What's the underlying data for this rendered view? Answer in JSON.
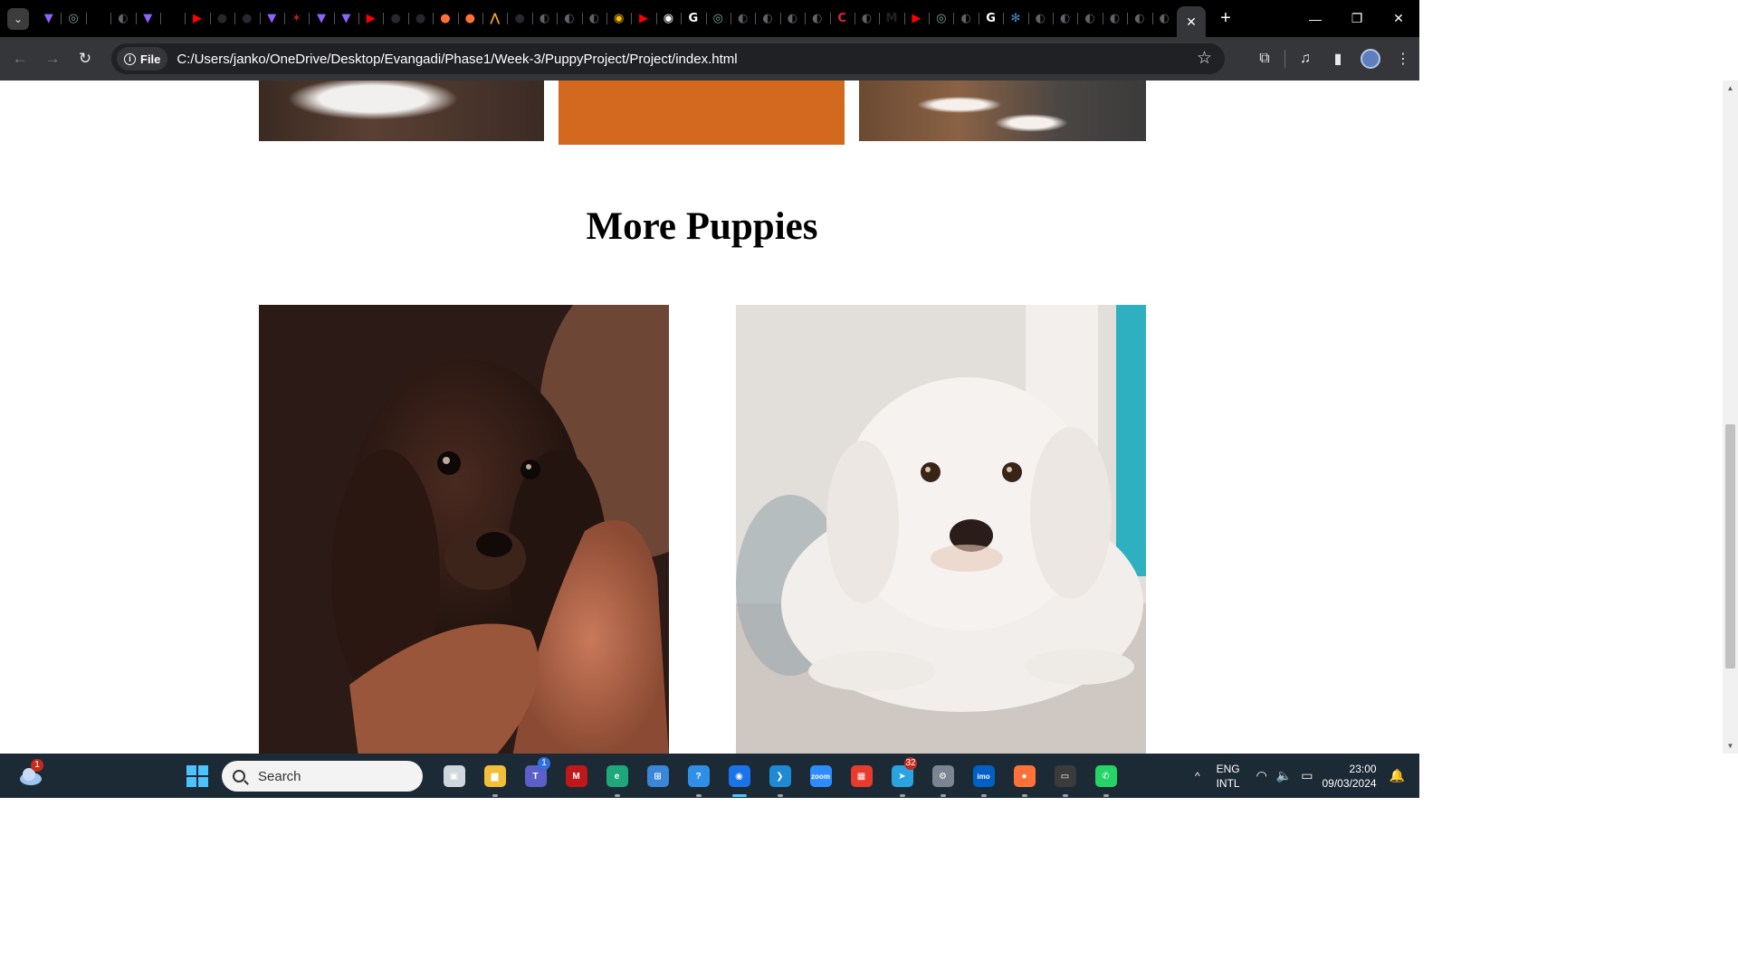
{
  "browser": {
    "tabs": [
      {
        "icon": "vite-icon",
        "color": "#8f62ff",
        "glyph": "▼"
      },
      {
        "icon": "chatgpt-icon",
        "color": "#74aa9c",
        "glyph": "◎"
      },
      {
        "icon": "blank-icon",
        "color": "#000000",
        "glyph": ""
      },
      {
        "icon": "globe-icon",
        "color": "#5f6368",
        "glyph": "◐"
      },
      {
        "icon": "vite-icon",
        "color": "#8f62ff",
        "glyph": "▼"
      },
      {
        "icon": "download-icon",
        "color": "#000000",
        "glyph": "⬇"
      },
      {
        "icon": "youtube-icon",
        "color": "#ff0000",
        "glyph": "▶"
      },
      {
        "icon": "github-icon",
        "color": "#24292f",
        "glyph": "●"
      },
      {
        "icon": "github-icon",
        "color": "#24292f",
        "glyph": "●"
      },
      {
        "icon": "vite-icon",
        "color": "#8f62ff",
        "glyph": "▼"
      },
      {
        "icon": "bug-icon",
        "color": "#b3261e",
        "glyph": "✶"
      },
      {
        "icon": "vite-icon",
        "color": "#8f62ff",
        "glyph": "▼"
      },
      {
        "icon": "vite-icon",
        "color": "#8f62ff",
        "glyph": "▼"
      },
      {
        "icon": "youtube-icon",
        "color": "#ff0000",
        "glyph": "▶"
      },
      {
        "icon": "github-icon",
        "color": "#24292f",
        "glyph": "●"
      },
      {
        "icon": "github-icon",
        "color": "#24292f",
        "glyph": "●"
      },
      {
        "icon": "firefox-icon",
        "color": "#ff7139",
        "glyph": "●"
      },
      {
        "icon": "firefox-icon",
        "color": "#ff7139",
        "glyph": "●"
      },
      {
        "icon": "vercel-icon",
        "color": "#f5a623",
        "glyph": "⋀"
      },
      {
        "icon": "github-icon",
        "color": "#24292f",
        "glyph": "●"
      },
      {
        "icon": "globe-icon",
        "color": "#5f6368",
        "glyph": "◐"
      },
      {
        "icon": "globe-icon",
        "color": "#5f6368",
        "glyph": "◐"
      },
      {
        "icon": "globe-icon",
        "color": "#5f6368",
        "glyph": "◐"
      },
      {
        "icon": "chrome-icon",
        "color": "#fbbc04",
        "glyph": "◉"
      },
      {
        "icon": "youtube-icon",
        "color": "#ff0000",
        "glyph": "▶"
      },
      {
        "icon": "chrome-icon",
        "color": "#ffffff",
        "glyph": "◉"
      },
      {
        "icon": "google-icon",
        "color": "#ffffff",
        "glyph": "G"
      },
      {
        "icon": "chatgpt-icon",
        "color": "#74aa9c",
        "glyph": "◎"
      },
      {
        "icon": "globe-icon",
        "color": "#5f6368",
        "glyph": "◐"
      },
      {
        "icon": "globe-icon",
        "color": "#5f6368",
        "glyph": "◐"
      },
      {
        "icon": "globe-icon",
        "color": "#5f6368",
        "glyph": "◐"
      },
      {
        "icon": "globe-icon",
        "color": "#5f6368",
        "glyph": "◐"
      },
      {
        "icon": "c-icon",
        "color": "#e32636",
        "glyph": "C"
      },
      {
        "icon": "globe-icon",
        "color": "#5f6368",
        "glyph": "◐"
      },
      {
        "icon": "m-icon",
        "color": "#222222",
        "glyph": "M"
      },
      {
        "icon": "youtube-icon",
        "color": "#ff0000",
        "glyph": "▶"
      },
      {
        "icon": "chatgpt-icon",
        "color": "#74aa9c",
        "glyph": "◎"
      },
      {
        "icon": "globe-icon",
        "color": "#5f6368",
        "glyph": "◐"
      },
      {
        "icon": "google-icon",
        "color": "#ffffff",
        "glyph": "G"
      },
      {
        "icon": "settings-icon",
        "color": "#4a86c8",
        "glyph": "✻"
      },
      {
        "icon": "globe-icon",
        "color": "#5f6368",
        "glyph": "◐"
      },
      {
        "icon": "globe-icon",
        "color": "#5f6368",
        "glyph": "◐"
      },
      {
        "icon": "globe-icon",
        "color": "#5f6368",
        "glyph": "◐"
      },
      {
        "icon": "globe-icon",
        "color": "#5f6368",
        "glyph": "◐"
      },
      {
        "icon": "globe-icon",
        "color": "#5f6368",
        "glyph": "◐"
      },
      {
        "icon": "globe-icon",
        "color": "#5f6368",
        "glyph": "◐"
      }
    ],
    "new_tab": "+",
    "close_tab": "✕",
    "window_controls": {
      "minimize": "—",
      "restore": "❐",
      "close": "✕"
    },
    "address": {
      "scheme_label": "File",
      "url": "C:/Users/janko/OneDrive/Desktop/Evangadi/Phase1/Week-3/PuppyProject/Project/index.html"
    }
  },
  "page": {
    "section_title": "More Puppies",
    "accent_color": "#d2691e"
  },
  "taskbar": {
    "weather_badge": "1",
    "search_placeholder": "Search",
    "apps": [
      {
        "name": "task-view-icon",
        "color": "#cfd6dd",
        "glyph": "▣",
        "running": false
      },
      {
        "name": "file-explorer-icon",
        "color": "#f2c038",
        "glyph": "▆",
        "running": true
      },
      {
        "name": "teams-icon",
        "color": "#5b5fc7",
        "glyph": "T",
        "badge": "1",
        "running": false
      },
      {
        "name": "mcafee-icon",
        "color": "#c01818",
        "glyph": "M",
        "running": false
      },
      {
        "name": "edge-icon",
        "color": "#1fa67a",
        "glyph": "e",
        "running": true
      },
      {
        "name": "store-icon",
        "color": "#3a86d8",
        "glyph": "⊞",
        "running": false
      },
      {
        "name": "get-help-icon",
        "color": "#2f8fe8",
        "glyph": "?",
        "running": true
      },
      {
        "name": "chrome-icon",
        "color": "#1a73e8",
        "glyph": "◉",
        "running": true,
        "active": true
      },
      {
        "name": "vscode-icon",
        "color": "#1f8ad2",
        "glyph": "❯",
        "running": true
      },
      {
        "name": "zoom-icon",
        "color": "#2d8cff",
        "glyph": "zoom",
        "running": false
      },
      {
        "name": "office-icon",
        "color": "#e83a2d",
        "glyph": "▦",
        "running": false
      },
      {
        "name": "telegram-icon",
        "color": "#2aa3df",
        "glyph": "➤",
        "badge": "32",
        "running": true
      },
      {
        "name": "settings-icon",
        "color": "#7a8591",
        "glyph": "⚙",
        "running": true
      },
      {
        "name": "imo-icon",
        "color": "#0060c6",
        "glyph": "imo",
        "running": true
      },
      {
        "name": "firefox-icon",
        "color": "#ff7139",
        "glyph": "●",
        "running": true
      },
      {
        "name": "terminal-icon",
        "color": "#3b3b3b",
        "glyph": "▭",
        "running": true
      },
      {
        "name": "whatsapp-icon",
        "color": "#25d366",
        "glyph": "✆",
        "running": true
      }
    ],
    "tray": {
      "lang_line1": "ENG",
      "lang_line2": "INTL",
      "time": "23:00",
      "date": "09/03/2024"
    }
  }
}
